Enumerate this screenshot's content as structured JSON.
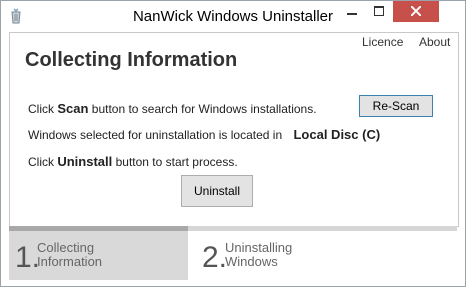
{
  "window": {
    "title": "NanWick Windows Uninstaller"
  },
  "header_links": {
    "licence": "Licence",
    "about": "About"
  },
  "main": {
    "heading": "Collecting Information",
    "line1_prefix": "Click",
    "line1_bold": "Scan",
    "line1_suffix": "button to search for Windows installations.",
    "line2_prefix": "Windows selected for uninstallation is located in",
    "line2_bold": "Local Disc (C)",
    "line3_prefix": "Click",
    "line3_bold": "Uninstall",
    "line3_suffix": "button to start process.",
    "rescan_label": "Re-Scan",
    "uninstall_label": "Uninstall"
  },
  "steps": [
    {
      "number": "1.",
      "line1": "Collecting",
      "line2": "Information"
    },
    {
      "number": "2.",
      "line1": "Uninstalling",
      "line2": "Windows"
    }
  ],
  "colors": {
    "close_button": "#c7504a",
    "active_step_bg": "#d9d9d9",
    "rescan_border": "#3c7fb1"
  },
  "icons": {
    "app": "recycle-bin-icon",
    "minimize": "minimize-icon",
    "maximize": "maximize-icon",
    "close": "close-icon"
  }
}
